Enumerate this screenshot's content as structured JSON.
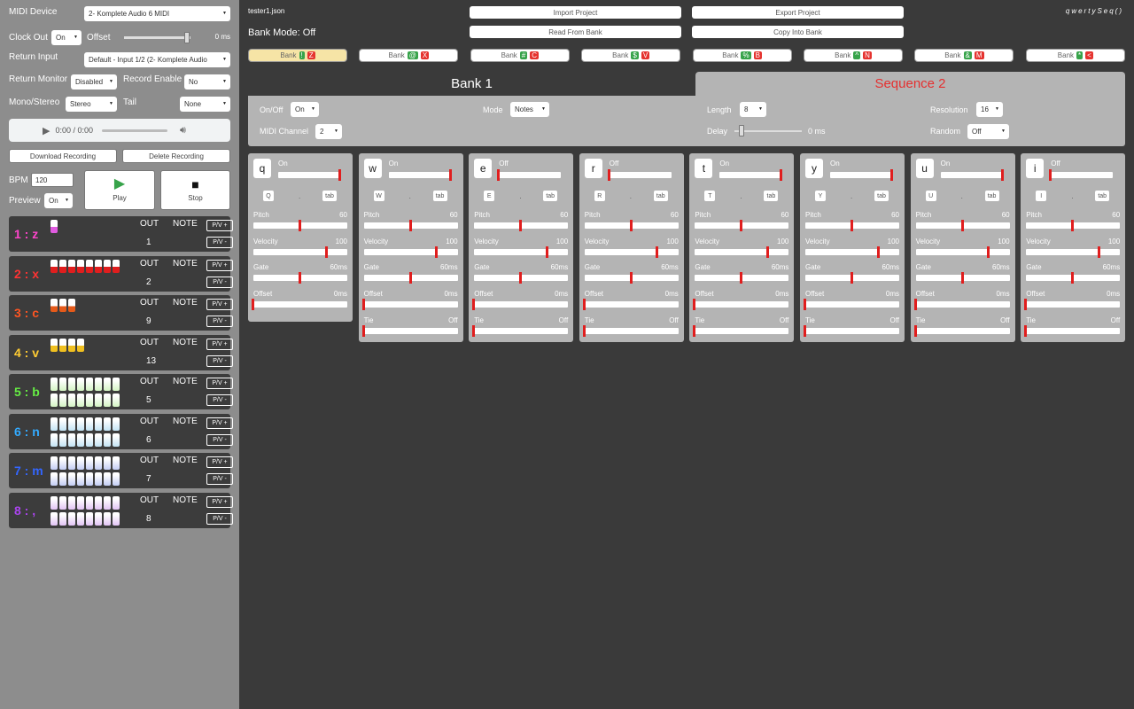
{
  "left": {
    "midi_device_label": "MIDI Device",
    "midi_device_value": "2- Komplete Audio 6 MIDI",
    "clock_out_label": "Clock Out",
    "clock_out_value": "On",
    "offset_label": "Offset",
    "offset_value": "0 ms",
    "offset_level": 0.95,
    "return_input_label": "Return Input",
    "return_input_value": "Default - Input 1/2 (2- Komplete Audio",
    "return_monitor_label": "Return Monitor",
    "return_monitor_value": "Disabled",
    "record_enable_label": "Record Enable",
    "record_enable_value": "No",
    "mono_stereo_label": "Mono/Stereo",
    "mono_stereo_value": "Stereo",
    "tail_label": "Tail",
    "tail_value": "None",
    "audio_time": "0:00 / 0:00",
    "download_recording": "Download Recording",
    "delete_recording": "Delete Recording",
    "bpm_label": "BPM",
    "bpm_value": "120",
    "preview_label": "Preview",
    "preview_value": "On",
    "play_label": "Play",
    "stop_label": "Stop",
    "out_label": "OUT",
    "note_label": "NOTE",
    "pv_plus": "P/V +",
    "pv_minus": "P/V -"
  },
  "tracks": [
    {
      "name": "1 : z",
      "color": "#ff44cc",
      "out": "1",
      "steps_top": 1,
      "steps_bottom": 0,
      "fill": "#e05be0",
      "style": "half"
    },
    {
      "name": "2 : x",
      "color": "#ff3333",
      "out": "2",
      "steps_top": 8,
      "steps_bottom": 0,
      "fill": "#e01e1e",
      "style": "half"
    },
    {
      "name": "3 : c",
      "color": "#ff5522",
      "out": "9",
      "steps_top": 3,
      "steps_bottom": 0,
      "fill": "#e55a1a",
      "style": "half"
    },
    {
      "name": "4 : v",
      "color": "#ffcc33",
      "out": "13",
      "steps_top": 4,
      "steps_bottom": 0,
      "fill": "#f0c020",
      "style": "half"
    },
    {
      "name": "5 : b",
      "color": "#66ee44",
      "out": "5",
      "steps_top": 8,
      "steps_bottom": 8,
      "fill": "#d4f5c4",
      "style": "grad"
    },
    {
      "name": "6 : n",
      "color": "#33aaff",
      "out": "6",
      "steps_top": 8,
      "steps_bottom": 8,
      "fill": "#c4e4f5",
      "style": "grad"
    },
    {
      "name": "7 : m",
      "color": "#3366ff",
      "out": "7",
      "steps_top": 8,
      "steps_bottom": 8,
      "fill": "#c4cef5",
      "style": "grad"
    },
    {
      "name": "8 : ,",
      "color": "#aa44ee",
      "out": "8",
      "steps_top": 8,
      "steps_bottom": 8,
      "fill": "#e2c4f5",
      "style": "grad"
    }
  ],
  "top": {
    "filename": "tester1.json",
    "bank_mode": "Bank Mode: Off",
    "import_project": "Import Project",
    "export_project": "Export Project",
    "read_from_bank": "Read From Bank",
    "copy_into_bank": "Copy Into Bank",
    "app_logo": "qwertySeq()"
  },
  "banks": [
    {
      "label": "Bank",
      "k1": "!",
      "k2": "Z",
      "active": true
    },
    {
      "label": "Bank",
      "k1": "@",
      "k2": "X",
      "active": false
    },
    {
      "label": "Bank",
      "k1": "#",
      "k2": "C",
      "active": false
    },
    {
      "label": "Bank",
      "k1": "$",
      "k2": "V",
      "active": false
    },
    {
      "label": "Bank",
      "k1": "%",
      "k2": "B",
      "active": false
    },
    {
      "label": "Bank",
      "k1": "^",
      "k2": "N",
      "active": false
    },
    {
      "label": "Bank",
      "k1": "&",
      "k2": "M",
      "active": false
    },
    {
      "label": "Bank",
      "k1": "*",
      "k2": "<",
      "active": false
    }
  ],
  "tabs": {
    "bank": "Bank 1",
    "sequence": "Sequence 2",
    "sequence_color": "#e53030"
  },
  "seq": {
    "onoff_label": "On/Off",
    "onoff_value": "On",
    "mode_label": "Mode",
    "mode_value": "Notes",
    "length_label": "Length",
    "length_value": "8",
    "resolution_label": "Resolution",
    "resolution_value": "16",
    "midi_channel_label": "MIDI Channel",
    "midi_channel_value": "2",
    "delay_label": "Delay",
    "delay_value": "0 ms",
    "delay_level": 0.1,
    "random_label": "Random",
    "random_value": "Off"
  },
  "param_labels": {
    "pitch": "Pitch",
    "velocity": "Velocity",
    "gate": "Gate",
    "offset": "Offset",
    "tie": "Tie",
    "dot": ".",
    "tab": "tab"
  },
  "steps": [
    {
      "key": "q",
      "upper": "Q",
      "state": "On",
      "level": 1.0,
      "pitch": "60",
      "velocity": "100",
      "gate": "60ms",
      "offset": "0ms",
      "tie": null,
      "pitch_pos": 0.5,
      "vel_pos": 0.78,
      "gate_pos": 0.5,
      "offset_pos": 0.0,
      "tie_pos": 0.0
    },
    {
      "key": "w",
      "upper": "W",
      "state": "On",
      "level": 1.0,
      "pitch": "60",
      "velocity": "100",
      "gate": "60ms",
      "offset": "0ms",
      "tie": "Off",
      "pitch_pos": 0.5,
      "vel_pos": 0.78,
      "gate_pos": 0.5,
      "offset_pos": 0.0,
      "tie_pos": 0.0
    },
    {
      "key": "e",
      "upper": "E",
      "state": "Off",
      "level": 0.0,
      "pitch": "60",
      "velocity": "100",
      "gate": "60ms",
      "offset": "0ms",
      "tie": "Off",
      "pitch_pos": 0.5,
      "vel_pos": 0.78,
      "gate_pos": 0.5,
      "offset_pos": 0.0,
      "tie_pos": 0.0
    },
    {
      "key": "r",
      "upper": "R",
      "state": "Off",
      "level": 0.0,
      "pitch": "60",
      "velocity": "100",
      "gate": "60ms",
      "offset": "0ms",
      "tie": "Off",
      "pitch_pos": 0.5,
      "vel_pos": 0.78,
      "gate_pos": 0.5,
      "offset_pos": 0.0,
      "tie_pos": 0.0
    },
    {
      "key": "t",
      "upper": "T",
      "state": "On",
      "level": 1.0,
      "pitch": "60",
      "velocity": "100",
      "gate": "60ms",
      "offset": "0ms",
      "tie": "Off",
      "pitch_pos": 0.5,
      "vel_pos": 0.78,
      "gate_pos": 0.5,
      "offset_pos": 0.0,
      "tie_pos": 0.0
    },
    {
      "key": "y",
      "upper": "Y",
      "state": "On",
      "level": 1.0,
      "pitch": "60",
      "velocity": "100",
      "gate": "60ms",
      "offset": "0ms",
      "tie": "Off",
      "pitch_pos": 0.5,
      "vel_pos": 0.78,
      "gate_pos": 0.5,
      "offset_pos": 0.0,
      "tie_pos": 0.0
    },
    {
      "key": "u",
      "upper": "U",
      "state": "On",
      "level": 1.0,
      "pitch": "60",
      "velocity": "100",
      "gate": "60ms",
      "offset": "0ms",
      "tie": "Off",
      "pitch_pos": 0.5,
      "vel_pos": 0.78,
      "gate_pos": 0.5,
      "offset_pos": 0.0,
      "tie_pos": 0.0
    },
    {
      "key": "i",
      "upper": "I",
      "state": "Off",
      "level": 0.0,
      "pitch": "60",
      "velocity": "100",
      "gate": "60ms",
      "offset": "0ms",
      "tie": "Off",
      "pitch_pos": 0.5,
      "vel_pos": 0.78,
      "gate_pos": 0.5,
      "offset_pos": 0.0,
      "tie_pos": 0.0
    }
  ]
}
